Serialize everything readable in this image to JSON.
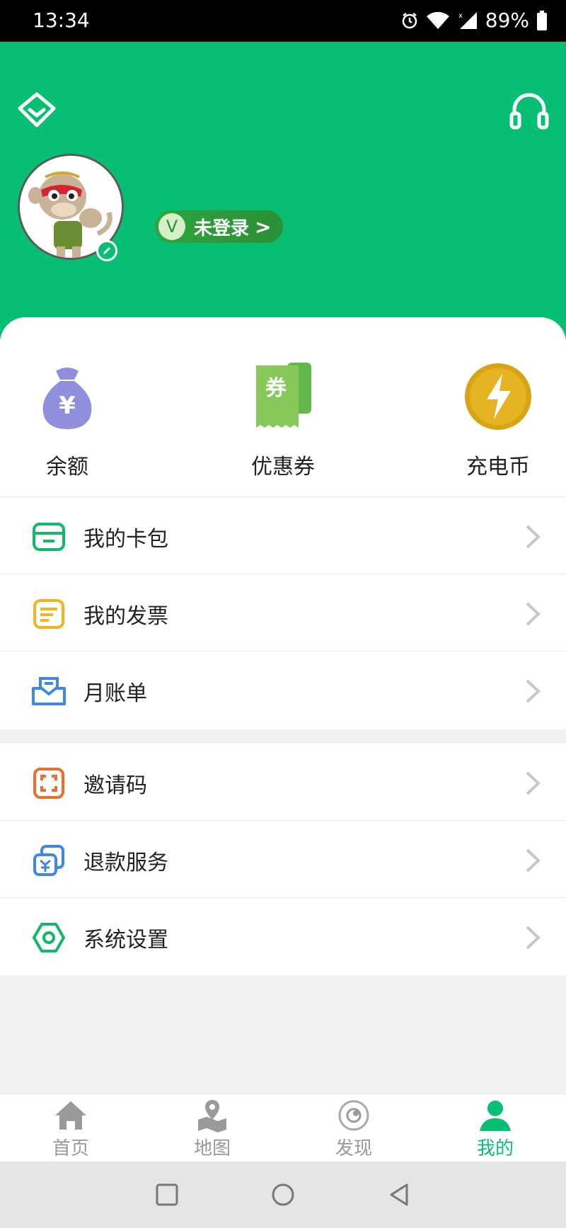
{
  "status_bar": {
    "time": "13:34",
    "battery": "89%"
  },
  "header": {
    "login_label": "未登录",
    "login_badge": "V"
  },
  "quick_actions": [
    {
      "label": "余额",
      "icon": "money-bag-icon",
      "glyph": "¥"
    },
    {
      "label": "优惠券",
      "icon": "coupon-icon",
      "glyph": "券"
    },
    {
      "label": "充电币",
      "icon": "charge-coin-icon"
    }
  ],
  "menu": [
    {
      "label": "我的卡包",
      "icon": "card-wallet-icon"
    },
    {
      "label": "我的发票",
      "icon": "invoice-icon"
    },
    {
      "label": "月账单",
      "icon": "monthly-bill-icon"
    },
    {
      "label": "邀请码",
      "icon": "scan-frame-icon"
    },
    {
      "label": "退款服务",
      "icon": "refund-icon"
    },
    {
      "label": "系统设置",
      "icon": "settings-icon"
    }
  ],
  "tabs": [
    {
      "label": "首页",
      "icon": "home-icon"
    },
    {
      "label": "地图",
      "icon": "map-icon"
    },
    {
      "label": "发现",
      "icon": "discover-icon"
    },
    {
      "label": "我的",
      "icon": "profile-icon",
      "active": true
    }
  ],
  "colors": {
    "brand": "#07bf72",
    "inactive": "#999999"
  }
}
